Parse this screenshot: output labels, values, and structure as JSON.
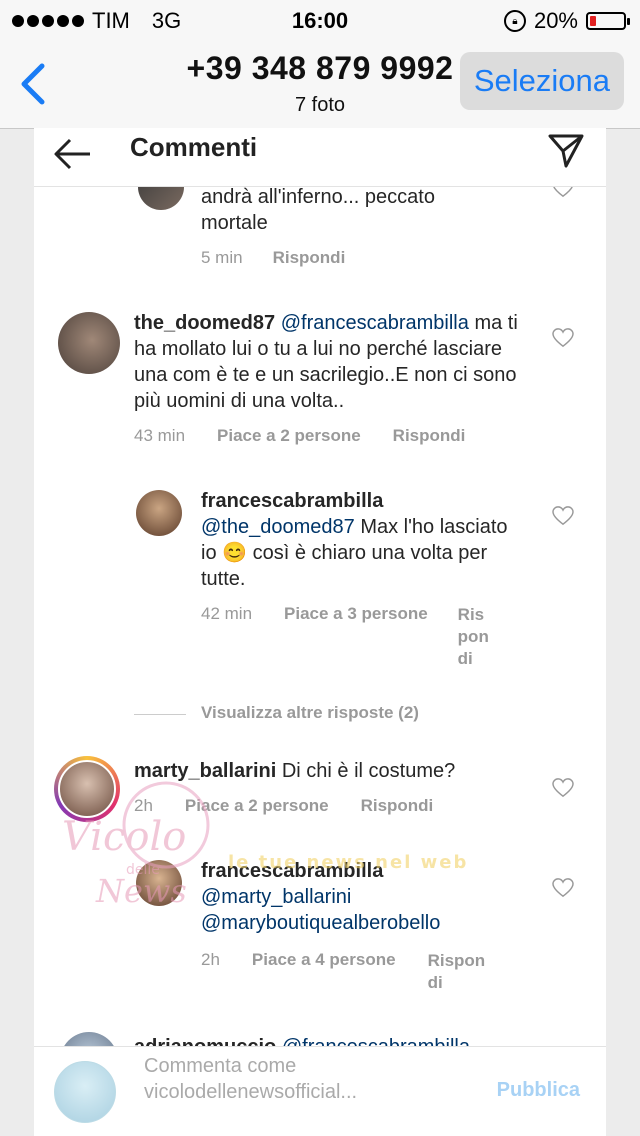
{
  "status_bar": {
    "carrier": "TIM",
    "network": "3G",
    "time": "16:00",
    "battery_percent": "20%",
    "battery_level": 0.2,
    "battery_color": "#e02020"
  },
  "viewer_nav": {
    "back_icon": "chevron-left-icon",
    "title": "+39 348 879 9992",
    "subtitle": "7 foto",
    "select_label": "Seleziona",
    "accent": "#1a7cf5"
  },
  "screen": {
    "header": {
      "title": "Commenti",
      "back_icon": "arrow-left-icon",
      "send_icon": "paper-plane-icon"
    },
    "comments": [
      {
        "text": "andrà all'inferno... peccato mortale",
        "time": "5 min",
        "reply_label": "Rispondi"
      },
      {
        "username": "the_doomed87",
        "mention": "@francescabrambilla",
        "text": "ma ti ha mollato lui o tu a lui no perché lasciare una com è te e un sacrilegio..E non ci sono più uomini di una volta..",
        "time": "43 min",
        "likes": "Piace a 2 persone",
        "reply_label": "Rispondi"
      },
      {
        "username": "francescabrambilla",
        "mention": "@the_doomed87",
        "text": "Max l'ho lasciato io",
        "emoji": "😊",
        "text2": "così è chiaro una volta per tutte.",
        "time": "42 min",
        "likes": "Piace a 3 persone",
        "reply_label": "Rispondi"
      },
      {
        "username": "marty_ballarini",
        "text": "Di chi è il costume?",
        "time": "2h",
        "likes": "Piace a 2 persone",
        "reply_label": "Rispondi"
      },
      {
        "username": "francescabrambilla",
        "mention": "@marty_ballarini",
        "mention2": "@maryboutiquealberobello",
        "time": "2h",
        "likes": "Piace a 4 persone",
        "reply_label": "Rispondi"
      },
      {
        "username": "adrianomuccio",
        "mention": "@francescabrambilla"
      }
    ],
    "view_more": "Visualizza altre risposte (2)",
    "footer": {
      "placeholder": "Commenta come vicolodellenewsofficial...",
      "post_label": "Pubblica"
    }
  },
  "watermark": {
    "text1": "Vicolo",
    "text2": "delle",
    "text3": "News",
    "text4": "le tue news nel web"
  }
}
